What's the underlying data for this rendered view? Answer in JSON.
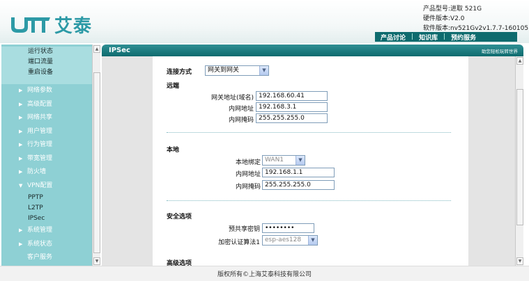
{
  "header": {
    "brand_name": "艾泰",
    "logo_mark": "UTT",
    "product_model": "产品型号:进取 521G",
    "hardware_version": "硬件版本:V2.0",
    "software_version": "软件版本:nv521Gv2v1.7.7-160105",
    "nav": [
      "产品讨论",
      "知识库",
      "预约服务"
    ]
  },
  "sidebar": {
    "top_items": [
      "运行状态",
      "端口流量",
      "重启设备"
    ],
    "items": [
      {
        "label": "网络参数",
        "arrow": "▶"
      },
      {
        "label": "高级配置",
        "arrow": "▶"
      },
      {
        "label": "网络共享",
        "arrow": "▶"
      },
      {
        "label": "用户管理",
        "arrow": "▶"
      },
      {
        "label": "行为管理",
        "arrow": "▶"
      },
      {
        "label": "带宽管理",
        "arrow": "▶"
      },
      {
        "label": "防火墙",
        "arrow": "▶"
      },
      {
        "label": "VPN配置",
        "arrow": "▼"
      }
    ],
    "vpn_sub": [
      "PPTP",
      "L2TP",
      "IPSec"
    ],
    "bottom_items": [
      {
        "label": "系统管理",
        "arrow": "▶"
      },
      {
        "label": "系统状态",
        "arrow": "▶"
      },
      {
        "label": "客户服务",
        "arrow": ""
      }
    ]
  },
  "main": {
    "title": "IPSec",
    "help_link": "助您轻松玩转世界",
    "connection_type": {
      "label": "连接方式",
      "value": "网关到网关"
    },
    "remote": {
      "title": "远端",
      "gateway_label": "网关地址(域名)",
      "gateway_value": "192.168.60.41",
      "lan_ip_label": "内网地址",
      "lan_ip_value": "192.168.3.1",
      "lan_mask_label": "内网掩码",
      "lan_mask_value": "255.255.255.0"
    },
    "local": {
      "title": "本地",
      "bind_label": "本地绑定",
      "bind_value": "WAN1",
      "lan_ip_label": "内网地址",
      "lan_ip_value": "192.168.1.1",
      "lan_mask_label": "内网掩码",
      "lan_mask_value": "255.255.255.0"
    },
    "security": {
      "title": "安全选项",
      "psk_label": "预共享密钥",
      "psk_value": "••••••••",
      "encrypt_label": "加密认证算法1",
      "encrypt_value": "esp-aes128"
    },
    "advanced": {
      "title": "高级选项"
    }
  },
  "footer": {
    "copyright": "版权所有©上海艾泰科技有限公司"
  },
  "colors": {
    "accent": "#0e6b6e",
    "sidebar": "#8ed0d4",
    "logo": "#2d9aa6"
  }
}
